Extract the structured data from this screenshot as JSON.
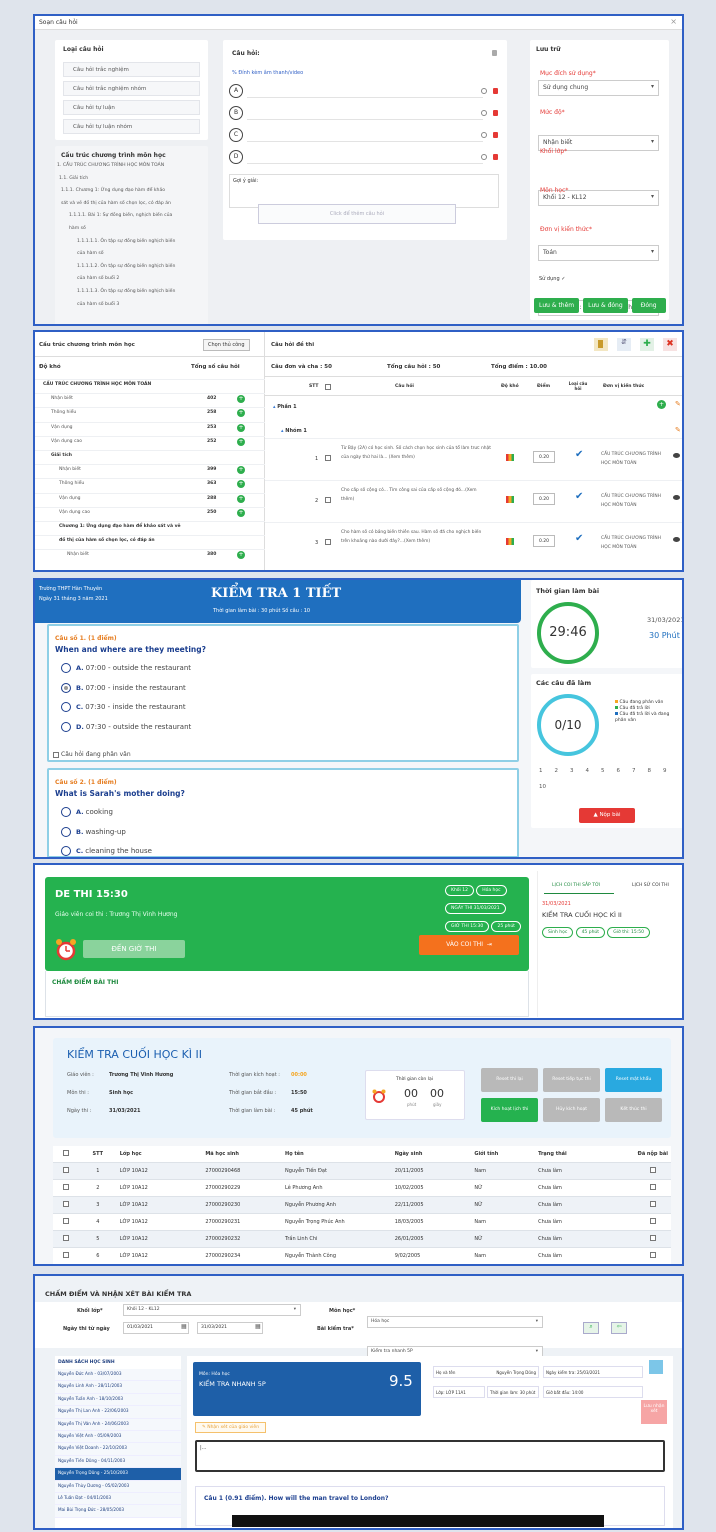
{
  "p1": {
    "title": "Soạn câu hỏi",
    "close": "×",
    "left_title": "Loại câu hỏi",
    "types": [
      "Câu hỏi trắc nghiệm",
      "Câu hỏi trắc nghiệm nhóm",
      "Câu hỏi tự luận",
      "Câu hỏi tự luận nhóm"
    ],
    "struct_title": "Cấu trúc chương trình môn học",
    "tree": [
      "1. CẤU TRÚC CHƯƠNG TRÌNH HỌC MÔN TOÁN",
      "1.1. Giải tích",
      "1.1.1. Chương 1: Ứng dụng đạo hàm để khảo",
      "sát và vẽ đồ thị của hàm số chọn lọc, có đáp án",
      "1.1.1.1. Bài 1: Sự đồng biến, nghịch biến của",
      "hàm số",
      "1.1.1.1.1. Ôn tập sự đồng biến nghịch biến",
      "của hàm số",
      "1.1.1.1.2. Ôn tập sự đồng biến nghịch biến",
      "của hàm số buổi 2",
      "1.1.1.1.3. Ôn tập sự đồng biến nghịch biến",
      "của hàm số buổi 3"
    ],
    "q_title": "Câu hỏi:",
    "media": "% Đính kèm âm thanh/video",
    "options": [
      "A",
      "B",
      "C",
      "D"
    ],
    "hint": "Gợi ý giải:",
    "add_q": "Click để thêm câu hỏi",
    "save_title": "Lưu trữ",
    "fields": [
      {
        "label": "Mục đích sử dụng*",
        "value": "Sử dụng chung"
      },
      {
        "label": "Mức độ*",
        "value": "Nhận biết"
      },
      {
        "label": "Khối lớp*",
        "value": "Khối 12 - KL12"
      },
      {
        "label": "Môn học*",
        "value": "Toán"
      },
      {
        "label": "Đơn vị kiến thức*",
        "value": "1. Chương 1: Ứng dụng đạo h..."
      }
    ],
    "use": "Sử dụng ✓",
    "buttons": [
      "Lưu & thêm",
      "Lưu & đóng",
      "Đóng"
    ]
  },
  "p2": {
    "left_title": "Cấu trúc chương trình môn học",
    "choose": "Chọn thủ công",
    "col1": "Độ khó",
    "col2": "Tổng số câu hỏi",
    "tree": [
      {
        "l": "CẤU TRÚC CHƯƠNG TRÌNH HỌC MÔN TOÁN",
        "v": "",
        "d": 0
      },
      {
        "l": "Nhận biết",
        "v": "402",
        "d": 1
      },
      {
        "l": "Thông hiểu",
        "v": "258",
        "d": 1
      },
      {
        "l": "Vận dụng",
        "v": "253",
        "d": 1
      },
      {
        "l": "Vận dụng cao",
        "v": "252",
        "d": 1
      },
      {
        "l": "Giải tích",
        "v": "",
        "d": 1
      },
      {
        "l": "Nhận biết",
        "v": "399",
        "d": 2
      },
      {
        "l": "Thông hiểu",
        "v": "363",
        "d": 2
      },
      {
        "l": "Vận dụng",
        "v": "288",
        "d": 2
      },
      {
        "l": "Vận dụng cao",
        "v": "250",
        "d": 2
      },
      {
        "l": "Chương 1: Ứng dụng đạo hàm để khảo sát và vẽ",
        "v": "",
        "d": 2
      },
      {
        "l": "đồ thị của hàm số chọn lọc, có đáp án",
        "v": "",
        "d": 2
      },
      {
        "l": "Nhận biết",
        "v": "380",
        "d": 3
      }
    ],
    "right_title": "Câu hỏi đề thi",
    "stats": [
      "Câu đơn và cha : 50",
      "Tổng câu hỏi : 50",
      "Tổng điểm : 10.00"
    ],
    "headers": [
      "STT",
      "",
      "Câu hỏi",
      "Độ khó",
      "Điểm",
      "Loại câu hỏi",
      "Đơn vị kiến thức"
    ],
    "part": "Phần 1",
    "group": "Nhóm 1",
    "rows": [
      {
        "n": "1",
        "q": "Từ Bậy (2A) có học sinh. Số cách chọn học sinh của tổ làm trưc nhật của ngày thứ hai là... (Xem thêm)",
        "p": "0.20",
        "u": "CẤU TRÚC CHƯƠNG TRÌNH HỌC MÔN TOÁN"
      },
      {
        "n": "2",
        "q": "Cho cấp số cộng có... Tìm công sai của cấp số cộng đó...(Xem thêm)",
        "p": "0.20",
        "u": "CẤU TRÚC CHƯƠNG TRÌNH HỌC MÔN TOÁN"
      },
      {
        "n": "3",
        "q": "Cho hàm số có bảng biến thiên sau. Hàm số đã cho nghịch biến trên khoảng nào dưới đây?...(Xem thêm)",
        "p": "0.20",
        "u": "CẤU TRÚC CHƯƠNG TRÌNH HỌC MÔN TOÁN"
      }
    ]
  },
  "p3": {
    "school": "Trường THPT Hàn Thuyên",
    "date": "Ngày 31 tháng 3 năm 2021",
    "title": "KIỂM TRA 1 TIẾT",
    "sub": "Thời gian làm bài : 30 phút    Số câu : 10",
    "q1_label": "Câu số 1. (1 điểm)",
    "q1": "When and where are they meeting?",
    "q1_opts": [
      {
        "k": "A.",
        "t": "07:00 - outside the restaurant"
      },
      {
        "k": "B.",
        "t": "07:00 - inside the restaurant"
      },
      {
        "k": "C.",
        "t": "07:30 - inside the restaurant"
      },
      {
        "k": "D.",
        "t": "07:30 - outside the restaurant"
      }
    ],
    "unsure": "Câu hỏi đang phân vân",
    "q2_label": "Câu số 2. (1 điểm)",
    "q2": "What is Sarah's mother doing?",
    "q2_opts": [
      {
        "k": "A.",
        "t": "cooking"
      },
      {
        "k": "B.",
        "t": "washing-up"
      },
      {
        "k": "C.",
        "t": "cleaning the house"
      }
    ],
    "time_title": "Thời gian làm bài",
    "timer": "29:46",
    "tdate": "31/03/2021",
    "tlen": "30 Phút",
    "done_title": "Các câu đã làm",
    "done": "0/10",
    "legend": [
      "Câu đang phân vân",
      "Câu đã trả lời",
      "Câu đã trả lời và đang phân vân"
    ],
    "nums": [
      "1",
      "2",
      "3",
      "4",
      "5",
      "6",
      "7",
      "8",
      "9",
      "10"
    ],
    "submit": "Nộp bài"
  },
  "p4": {
    "title": "DE THI 15:30",
    "teacher": "Giáo viên coi thi : Trương Thị Vinh Hương",
    "tags": [
      "Khối 12",
      "Hóa học",
      "NGÀY THI 31/03/2021",
      "GIỜ THI 15:30",
      "25 phút"
    ],
    "time_btn": "ĐẾN GIỜ THI",
    "enter": "VÀO COI THI",
    "grade": "CHẤM ĐIỂM BÀI THI",
    "tab1": "LỊCH COI THI SẮP TỚI",
    "tab2": "LỊCH SỬ COI THI",
    "next_date": "31/03/2021",
    "next_title": "KIỂM TRA CUỐI HỌC KÌ II",
    "chips": [
      "Sinh học",
      "45 phút",
      "Giờ thi: 15:50"
    ]
  },
  "p5": {
    "title": "KIỂM TRA CUỐI HỌC KÌ II",
    "info": [
      {
        "k": "Giáo viên :",
        "v": "Trương Thị Vinh Hương"
      },
      {
        "k": "Môn thi :",
        "v": "Sinh học"
      },
      {
        "k": "Ngày thi :",
        "v": "31/03/2021"
      }
    ],
    "info2": [
      {
        "k": "Thời gian kích hoạt :",
        "v": "00:00"
      },
      {
        "k": "Thời gian bắt đầu :",
        "v": "15:50"
      },
      {
        "k": "Thời gian làm bài :",
        "v": "45 phút"
      }
    ],
    "remain": "Thời gian còn lại",
    "mm": "00",
    "ss": "00",
    "mm_l": "phút",
    "ss_l": "giây",
    "btns": [
      "Reset thi lại",
      "Reset tiếp tục thi",
      "Reset mật khẩu",
      "Kích hoạt lịch thi",
      "Hủy kích hoạt",
      "Kết thúc thi"
    ],
    "headers": [
      "",
      "STT",
      "Lớp học",
      "Mã học sinh",
      "Họ tên",
      "Ngày sinh",
      "Giới tính",
      "Trạng thái",
      "Đã nộp bài"
    ],
    "rows": [
      [
        "1",
        "LỚP 10A12",
        "27000290468",
        "Nguyễn Tiến Đạt",
        "20/11/2005",
        "Nam",
        "Chưa làm"
      ],
      [
        "2",
        "LỚP 10A12",
        "27000290229",
        "Lê Phương Anh",
        "10/02/2005",
        "NỮ",
        "Chưa làm"
      ],
      [
        "3",
        "LỚP 10A12",
        "27000290230",
        "Nguyễn Phương Anh",
        "22/11/2005",
        "NỮ",
        "Chưa làm"
      ],
      [
        "4",
        "LỚP 10A12",
        "27000290231",
        "Nguyễn Trọng Phúc Anh",
        "18/03/2005",
        "Nam",
        "Chưa làm"
      ],
      [
        "5",
        "LỚP 10A12",
        "27000290232",
        "Trần Linh Chi",
        "26/01/2005",
        "NỮ",
        "Chưa làm"
      ],
      [
        "6",
        "LỚP 10A12",
        "27000290234",
        "Nguyễn Thành Công",
        "9/02/2005",
        "Nam",
        "Chưa làm"
      ]
    ]
  },
  "p6": {
    "title": "CHẤM ĐIỂM VÀ NHẬN XÉT BÀI KIỂM TRA",
    "f_grade": "Khối lớp*",
    "v_grade": "Khối 12 - KL12",
    "f_subj": "Môn học*",
    "v_subj": "Hóa học",
    "f_date": "Ngày thi từ ngày",
    "d1": "01/03/2021",
    "d2": "31/03/2021",
    "f_test": "Bài kiểm tra*",
    "v_test": "Kiểm tra nhanh 5P",
    "list_title": "DANH SÁCH HỌC SINH",
    "students": [
      "Nguyễn Đức Anh - 03/07/2003",
      "Nguyễn Linh Anh - 28/11/2003",
      "Nguyễn Tuấn Anh - 18/10/2003",
      "Nguyễn Thị Lan Anh - 22/06/2003",
      "Nguyễn Thị Vân Anh - 24/06/2003",
      "Nguyễn Việt Anh - 05/09/2003",
      "Nguyễn Việt Doanh - 22/10/2003",
      "Nguyễn Tiến Dũng - 04/11/2003",
      "Nguyễn Trọng Dũng - 25/10/2003",
      "Nguyễn Thùy Dương - 05/02/2003",
      "Lê Tuấn Đạt - 04/01/2003",
      "Mai Bùi Trọng Đức - 28/05/2003"
    ],
    "selected": 8,
    "subj_lbl": "Môn: Hóa học",
    "test_name": "KIỂM TRA NHANH 5P",
    "score": "9.5",
    "meta": [
      {
        "k": "Họ và tên",
        "v": "Nguyễn Trọng Dũng"
      },
      {
        "k": "Ngày kiểm tra:",
        "v": "25/03/2021"
      },
      {
        "k": "Lớp: LỚP 11A1",
        "v": ""
      },
      {
        "k": "Thời gian làm:",
        "v": "30 phút"
      },
      {
        "k": "Giờ bắt đầu:",
        "v": "14:00"
      }
    ],
    "comment_btn": "Nhận xét của giáo viên",
    "save": "Lưu nhận xét",
    "q": "Câu 1 (0.91 điểm). How will the man travel to London?"
  }
}
